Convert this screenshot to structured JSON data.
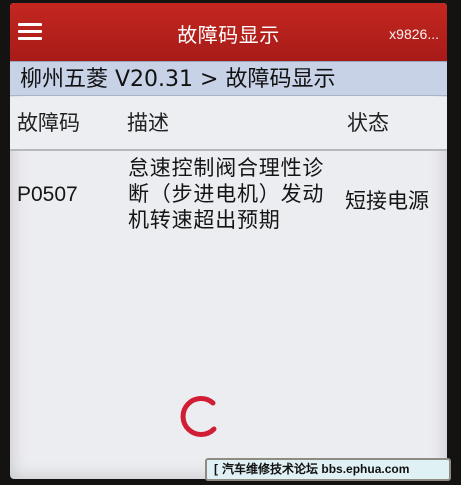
{
  "appbar": {
    "title": "故障码显示",
    "device_id": "x9826..."
  },
  "breadcrumb": "柳州五菱 V20.31 > 故障码显示",
  "table": {
    "headers": {
      "code": "故障码",
      "description": "描述",
      "status": "状态"
    },
    "rows": [
      {
        "code": "P0507",
        "description_lines": [
          "怠速控制阀合理性诊",
          "断（步进电机）发动",
          "机转速超出预期"
        ],
        "status": "短接电源"
      }
    ]
  },
  "watermark": {
    "left_bracket": "[",
    "text_cn": "汽车维修技术论坛",
    "url": "bbs.ephua.com"
  },
  "colors": {
    "appbar": "#b72019",
    "breadcrumb": "#c8d2e7",
    "loader": "#d11d35"
  }
}
